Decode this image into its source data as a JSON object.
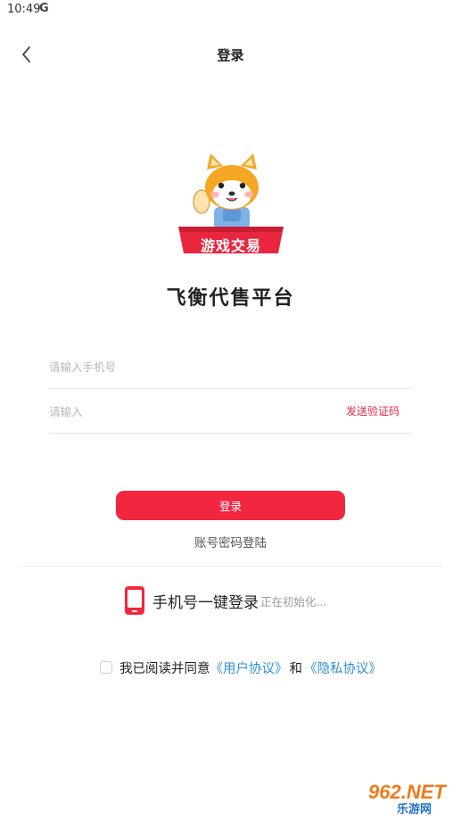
{
  "status_bar": {
    "time": "10:49",
    "g_icon": "G"
  },
  "nav": {
    "title": "登录",
    "back_icon": "chevron-left-icon"
  },
  "logo": {
    "badge_text": "游戏交易",
    "mascot": "shiba-dog"
  },
  "app_name": "飞衡代售平台",
  "form": {
    "phone_placeholder": "请输入手机号",
    "code_placeholder": "请输入",
    "send_code_label": "发送验证码",
    "login_label": "登录",
    "password_login_label": "账号密码登陆"
  },
  "one_key": {
    "label": "手机号一键登录",
    "status": "正在初始化..."
  },
  "agreement": {
    "prefix": "我已阅读并同意",
    "user_agreement": "《用户协议》",
    "and": "和",
    "privacy_policy": "《隐私协议》"
  },
  "watermark": {
    "top_text": "962.NET",
    "bottom_text": "乐游网"
  },
  "colors": {
    "accent": "#f2263f",
    "link": "#2f8fd8",
    "placeholder": "#b8b8b8"
  }
}
